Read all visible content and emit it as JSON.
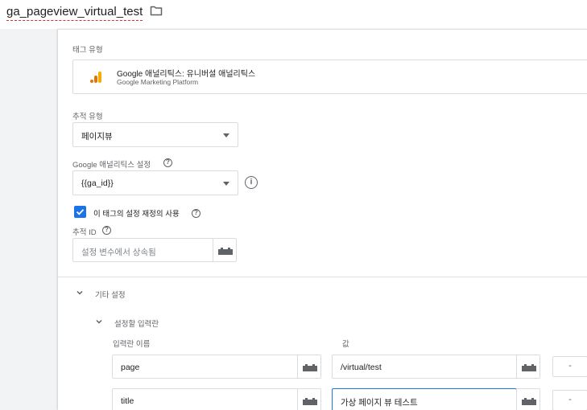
{
  "header": {
    "tag_name": "ga_pageview_virtual_test"
  },
  "tag_type": {
    "label": "태그 유형",
    "product_name": "Google 애널리틱스: 유니버설 애널리틱스",
    "product_platform": "Google Marketing Platform",
    "brand_color": "#f9ab00"
  },
  "track_type": {
    "label": "추적 유형",
    "value": "페이지뷰"
  },
  "ga_settings": {
    "label": "Google 애널리틱스 설정",
    "value": "{{ga_id}}"
  },
  "override": {
    "checked": true,
    "label": "이 태그의 설정 재정의 사용"
  },
  "tracking_id": {
    "label": "추적 ID",
    "placeholder": "설정 변수에서 상속됨"
  },
  "more_settings": {
    "label": "기타 설정",
    "fields_to_set": {
      "label": "설정할 입력란",
      "col_name": "입력란 이름",
      "col_value": "값",
      "rows": [
        {
          "name": "page",
          "value": "/virtual/test",
          "remove": "-"
        },
        {
          "name": "title",
          "value": "가상 페이지 뷰 테스트",
          "remove": "-"
        }
      ]
    }
  },
  "colors": {
    "accent": "#1a73e8",
    "border": "#dadce0",
    "text_secondary": "#5f6368"
  }
}
